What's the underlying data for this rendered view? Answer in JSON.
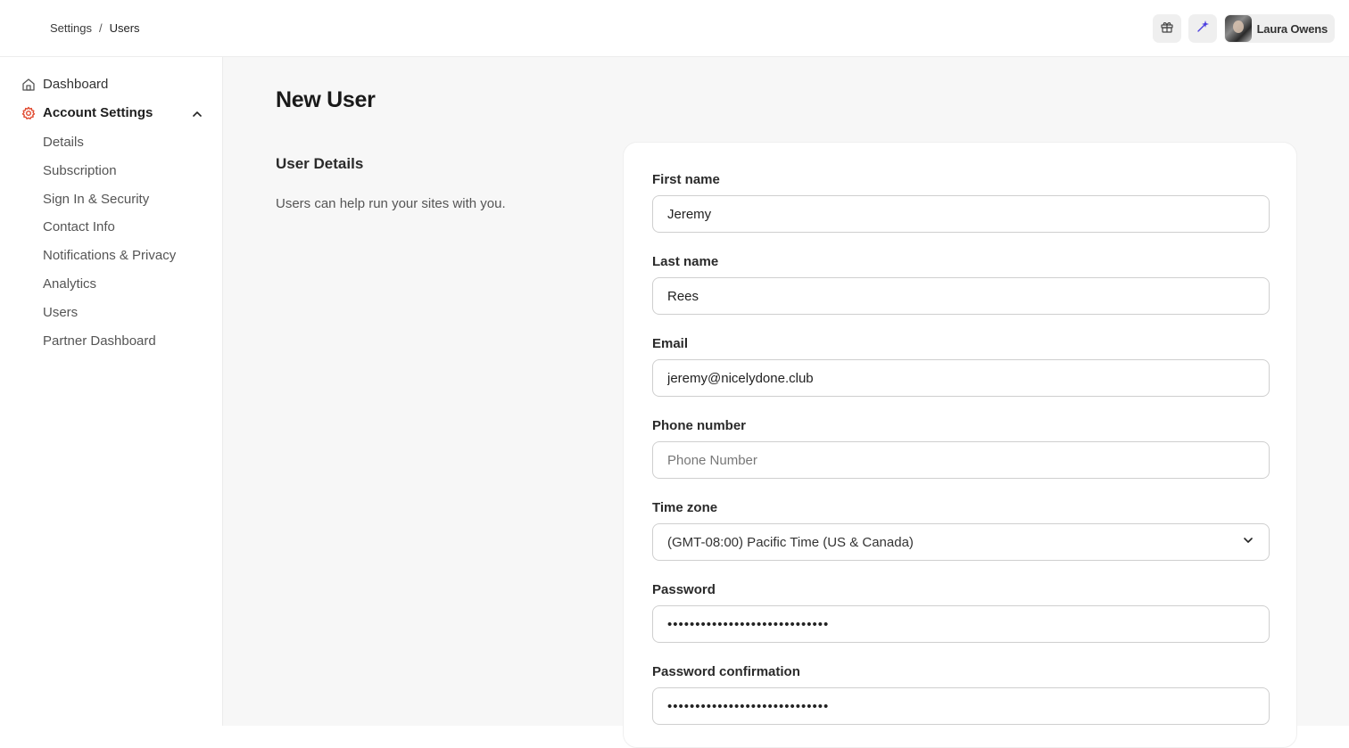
{
  "breadcrumb": {
    "parent": "Settings",
    "separator": "/",
    "current": "Users"
  },
  "topbar": {
    "user_name": "Laura Owens",
    "gift_icon": "gift-icon",
    "magic_icon": "magic-wand-icon"
  },
  "sidebar": {
    "dashboard": "Dashboard",
    "account_settings": "Account Settings",
    "items": [
      {
        "label": "Details"
      },
      {
        "label": "Subscription"
      },
      {
        "label": "Sign In & Security"
      },
      {
        "label": "Contact Info"
      },
      {
        "label": "Notifications & Privacy"
      },
      {
        "label": "Analytics"
      },
      {
        "label": "Users"
      },
      {
        "label": "Partner Dashboard"
      }
    ]
  },
  "main": {
    "title": "New User",
    "section_title": "User Details",
    "section_desc": "Users can help run your sites with you."
  },
  "form": {
    "first_name": {
      "label": "First name",
      "value": "Jeremy"
    },
    "last_name": {
      "label": "Last name",
      "value": "Rees"
    },
    "email": {
      "label": "Email",
      "value": "jeremy@nicelydone.club"
    },
    "phone": {
      "label": "Phone number",
      "value": "",
      "placeholder": "Phone Number"
    },
    "timezone": {
      "label": "Time zone",
      "value": "(GMT-08:00) Pacific Time (US & Canada)"
    },
    "password": {
      "label": "Password",
      "value": "•••••••••••••••••••••••••••••"
    },
    "password_confirm": {
      "label": "Password confirmation",
      "value": "•••••••••••••••••••••••••••••"
    }
  },
  "colors": {
    "accent": "#e0492f",
    "magic": "#4b3ee0",
    "background": "#f7f7f7"
  }
}
